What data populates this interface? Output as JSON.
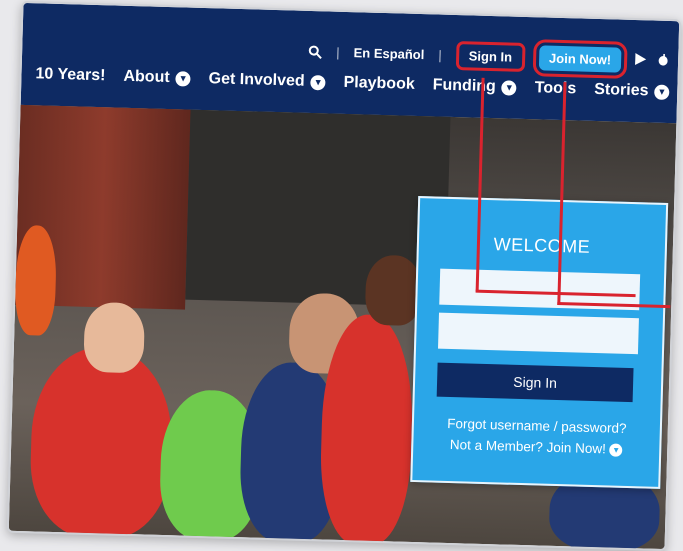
{
  "topbar": {
    "search_icon": "search-icon",
    "language": "En Español",
    "sign_in": "Sign In",
    "join_now": "Join Now!",
    "store_icons": [
      "google-play-icon",
      "apple-icon"
    ]
  },
  "menu": [
    {
      "label": "10 Years!"
    },
    {
      "label": "About"
    },
    {
      "label": "Get Involved"
    },
    {
      "label": "Playbook"
    },
    {
      "label": "Funding"
    },
    {
      "label": "Tools"
    },
    {
      "label": "Stories"
    }
  ],
  "login": {
    "title": "WELCOME",
    "username_placeholder": "",
    "password_placeholder": "",
    "submit": "Sign In",
    "forgot": "Forgot username / password?",
    "not_member": "Not a Member? Join Now!"
  },
  "colors": {
    "nav": "#0e2a63",
    "accent": "#2aa6e8",
    "highlight": "#d9232e"
  }
}
